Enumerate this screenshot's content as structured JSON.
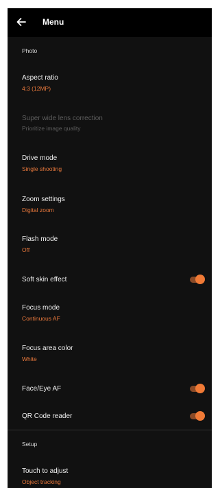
{
  "header": {
    "title": "Menu",
    "back_icon": "arrow-left-icon"
  },
  "sections": {
    "photo": "Photo",
    "setup": "Setup"
  },
  "items": {
    "aspect_ratio": {
      "label": "Aspect ratio",
      "value": "4:3 (12MP)"
    },
    "super_wide": {
      "label": "Super wide lens correction",
      "value": "Prioritize image quality",
      "enabled": false
    },
    "drive_mode": {
      "label": "Drive mode",
      "value": "Single shooting"
    },
    "zoom_settings": {
      "label": "Zoom settings",
      "value": "Digital zoom"
    },
    "flash_mode": {
      "label": "Flash mode",
      "value": "Off"
    },
    "soft_skin": {
      "label": "Soft skin effect",
      "on": true
    },
    "focus_mode": {
      "label": "Focus mode",
      "value": "Continuous AF"
    },
    "focus_area_color": {
      "label": "Focus area color",
      "value": "White"
    },
    "face_eye_af": {
      "label": "Face/Eye AF",
      "on": true
    },
    "qr_reader": {
      "label": "QR Code reader",
      "on": true
    },
    "touch_adjust": {
      "label": "Touch to adjust",
      "value": "Object tracking"
    }
  },
  "colors": {
    "background": "#111111",
    "accent": "#f07a36",
    "value_text": "#e8783c",
    "disabled_text": "#5d5d5d"
  }
}
